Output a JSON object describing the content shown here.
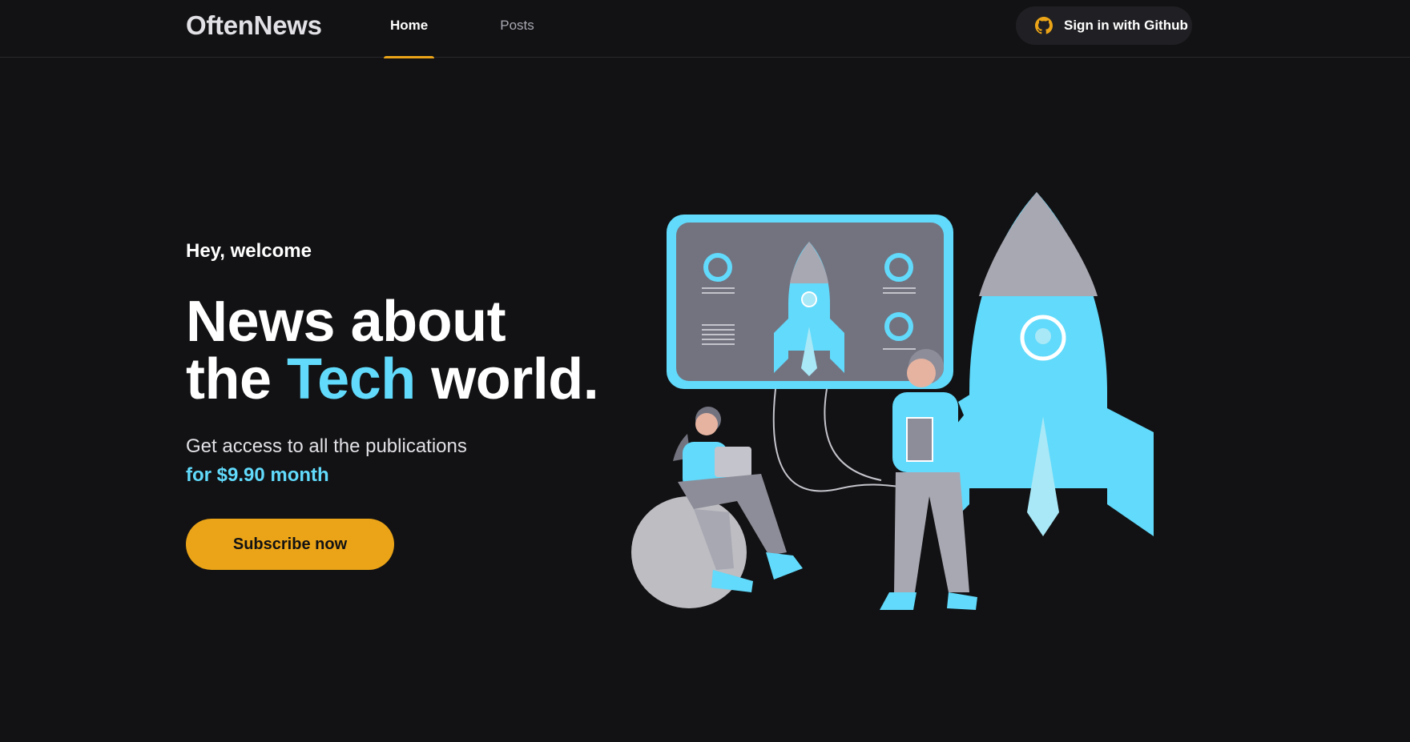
{
  "header": {
    "logo": "OftenNews",
    "nav": [
      {
        "label": "Home",
        "active": true
      },
      {
        "label": "Posts",
        "active": false
      }
    ],
    "signin_label": "Sign in with Github",
    "signin_icon": "github-icon"
  },
  "hero": {
    "greeting": "Hey, welcome",
    "title_line1": "News about",
    "title_line2_pre": "the",
    "title_accent": "Tech",
    "title_line2_post": "world.",
    "subtitle": "Get access to all the publications",
    "price": "for $9.90 month",
    "cta_label": "Subscribe now"
  },
  "colors": {
    "background": "#121214",
    "accent_cyan": "#61dafb",
    "accent_yellow": "#eba417",
    "button_dark": "#202024"
  }
}
